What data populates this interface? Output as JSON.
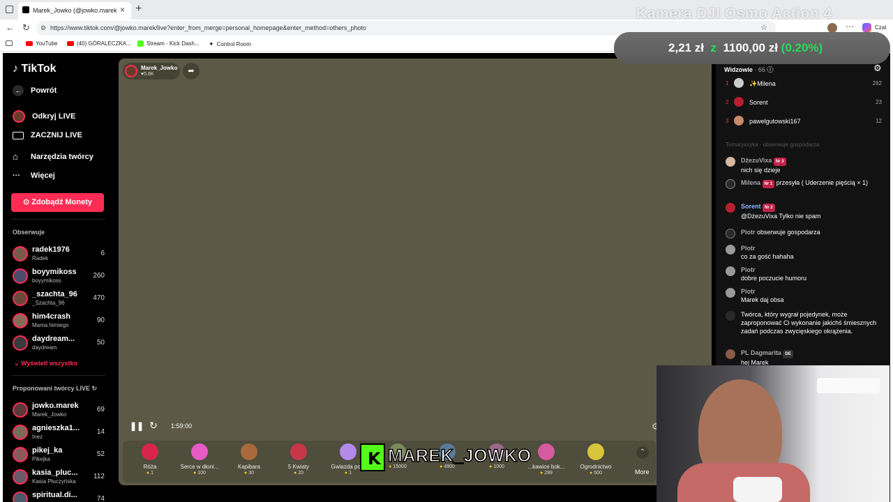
{
  "browser": {
    "tab_title": "Marek_Jowko (@jowko.marek) pro...",
    "url": "https://www.tiktok.com/@jowko.marek/live?enter_from_merge=personal_homepage&enter_method=others_photo",
    "chat_label": "Czat",
    "bookmarks": [
      "YouTube",
      "(40) GÓRALECZKA...",
      "Stream - Kick Dash...",
      "Control Room"
    ]
  },
  "overlay": {
    "camera_title": "Kamera DJI Osmo Action 4",
    "price_left": "2,21 zł",
    "price_mid": "1100,00 zł",
    "price_change": "(0.20%)",
    "kick_name": "MAREK_JOWKO"
  },
  "sidebar": {
    "logo": "TikTok",
    "back": "Powrót",
    "nav": [
      "Odkryj LIVE",
      "ZACZNIJ LIVE",
      "Narzędzia twórcy",
      "Więcej"
    ],
    "coins_button": "Zdobądź Monety",
    "following_header": "Obserwuje",
    "following": [
      {
        "name": "radek1976",
        "sub": "Radek",
        "count": "6"
      },
      {
        "name": "boyymikoss",
        "sub": "boyymikoss",
        "count": "260"
      },
      {
        "name": "_szachta_96",
        "sub": "_Szachta_96",
        "count": "470"
      },
      {
        "name": "him4crash",
        "sub": "Mama himiego",
        "count": "90"
      },
      {
        "name": "daydream...",
        "sub": "daydream",
        "count": "50"
      }
    ],
    "show_all": "Wyświetl wszystko",
    "suggested_header": "Proponowani twórcy LIVE",
    "suggested": [
      {
        "name": "jowko.marek",
        "sub": "Marek_Jowko",
        "count": "69"
      },
      {
        "name": "agnieszka1...",
        "sub": "Inez",
        "count": "14"
      },
      {
        "name": "pikej_ka",
        "sub": "Pikejka",
        "count": "52"
      },
      {
        "name": "kasia_pluc...",
        "sub": "Kasia Płuczyńska",
        "count": "112"
      },
      {
        "name": "spiritual.di...",
        "sub": "",
        "count": "74"
      }
    ]
  },
  "video": {
    "host_name": "Marek_Jowko",
    "host_likes": "5.8K",
    "time": "1:59:00",
    "more": "More",
    "gifts": [
      {
        "name": "Róża",
        "price": "1"
      },
      {
        "name": "Serce w dłoni...",
        "price": "100"
      },
      {
        "name": "Kapibara",
        "price": "30"
      },
      {
        "name": "5 Kwiaty",
        "price": "20"
      },
      {
        "name": "Gwiazda po...",
        "price": "1"
      },
      {
        "name": "",
        "price": "15000"
      },
      {
        "name": "",
        "price": "4900"
      },
      {
        "name": "",
        "price": "1000"
      },
      {
        "name": "...kawice bok...",
        "price": "299"
      },
      {
        "name": "Ogrodnictwo",
        "price": "500"
      }
    ]
  },
  "chat": {
    "viewers_label": "Widzowie",
    "viewers_count": "· 66",
    "top_viewers": [
      {
        "rank": "1",
        "name": "Milena",
        "score": "262"
      },
      {
        "rank": "2",
        "name": "Sorent",
        "score": "23"
      },
      {
        "rank": "3",
        "name": "pawelgutowski167",
        "score": "12"
      }
    ],
    "faded_line": "Tomaryxxyka · obserwuje gospodarza",
    "messages": [
      {
        "user": "DżezuVixa",
        "badge": "Nr 3",
        "text": "nich się dzieje"
      },
      {
        "user": "Milena",
        "badge": "Nr 1",
        "text": "przesyła ( Uderzenie pięścią × 1)"
      },
      {
        "user": "Sorent",
        "badge": "Nr 2",
        "text": "@DżezuVixa Tylko nie spam"
      },
      {
        "user": "Piotr",
        "badge": "",
        "text": "obserwuje gospodarza"
      },
      {
        "user": "Piotr",
        "badge": "",
        "text": "co za gość hahaha"
      },
      {
        "user": "Piotr",
        "badge": "",
        "text": "dobre poczucie humoru"
      },
      {
        "user": "Piotr",
        "badge": "",
        "text": "Marek daj obsa"
      },
      {
        "user": "",
        "badge": "",
        "text": "Twórca, który wygrał pojedynek, może zaproponować Ci wykonanie jakichś śmiesznych zadań podczas zwycięskiego okrążenia."
      },
      {
        "user": "PL Dagmarita",
        "badge": "DE",
        "text": "hej Marek"
      }
    ]
  }
}
